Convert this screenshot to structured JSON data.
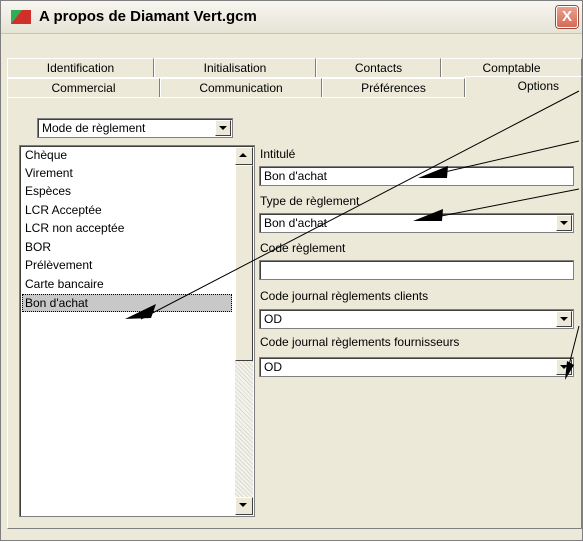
{
  "window": {
    "title": "A propos de Diamant Vert.gcm",
    "close_glyph": "X"
  },
  "tabs": {
    "row1": [
      "Identification",
      "Initialisation",
      "Contacts",
      "Comptable"
    ],
    "row2": [
      "Commercial",
      "Communication",
      "Préférences",
      "Options"
    ],
    "active": "Options"
  },
  "category_select": {
    "value": "Mode de règlement"
  },
  "payment_list": {
    "items": [
      "Chèque",
      "Virement",
      "Espèces",
      "LCR Acceptée",
      "LCR non acceptée",
      "BOR",
      "Prélèvement",
      "Carte bancaire",
      "Bon d'achat"
    ],
    "selected_index": 8
  },
  "form": {
    "intitule_label": "Intitulé",
    "intitule_value": "Bon d'achat",
    "type_label": "Type de règlement",
    "type_value": "Bon d'achat",
    "code_label": "Code règlement",
    "code_value": "",
    "journal_clients_label": "Code journal règlements clients",
    "journal_clients_value": "OD",
    "journal_fournisseurs_label": "Code journal règlements fournisseurs",
    "journal_fournisseurs_value": "OD"
  },
  "colors": {
    "window_bg": "#ece9d8",
    "close_button": "#d66a54",
    "icon_green": "#2fae5a",
    "icon_red": "#d0302a"
  }
}
